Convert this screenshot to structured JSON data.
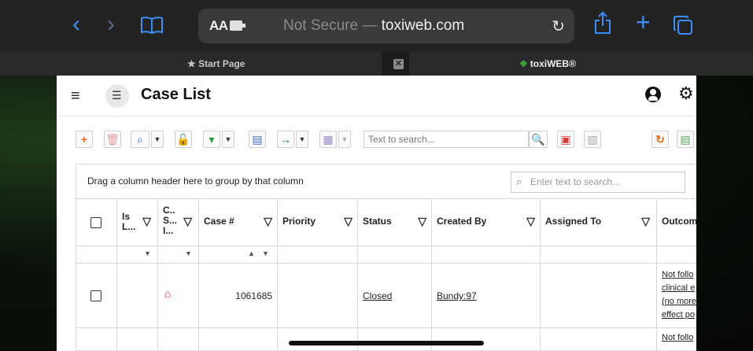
{
  "browser": {
    "text_size_label": "AA",
    "not_secure": "Not Secure —",
    "domain": "toxiweb.com",
    "tabs": [
      {
        "label": "Start Page"
      },
      {
        "label": "toxiWEB®"
      }
    ]
  },
  "page": {
    "title": "Case List"
  },
  "toolbar": {
    "search_placeholder": "Text to search..."
  },
  "grid": {
    "group_hint": "Drag a column header here to group by that column",
    "search_placeholder": "Enter text to search...",
    "columns": [
      {
        "label": "Is\nL..."
      },
      {
        "label": "C..\nS...\nI..."
      },
      {
        "label": "Case #"
      },
      {
        "label": "Priority"
      },
      {
        "label": "Status"
      },
      {
        "label": "Created By"
      },
      {
        "label": "Assigned To"
      },
      {
        "label": "Outcom"
      }
    ],
    "rows": [
      {
        "case_number": "1061685",
        "status": "Closed",
        "created_by": "Bundy:97",
        "outcome_lines": [
          "Not follo",
          "clinical e",
          "(no more",
          "effect po"
        ]
      },
      {
        "outcome_lines": [
          "Not follo"
        ]
      }
    ]
  },
  "colors": {
    "accent": "#3e8ef7",
    "safari_bar": "#232323",
    "page_bg": "#ffffff"
  }
}
